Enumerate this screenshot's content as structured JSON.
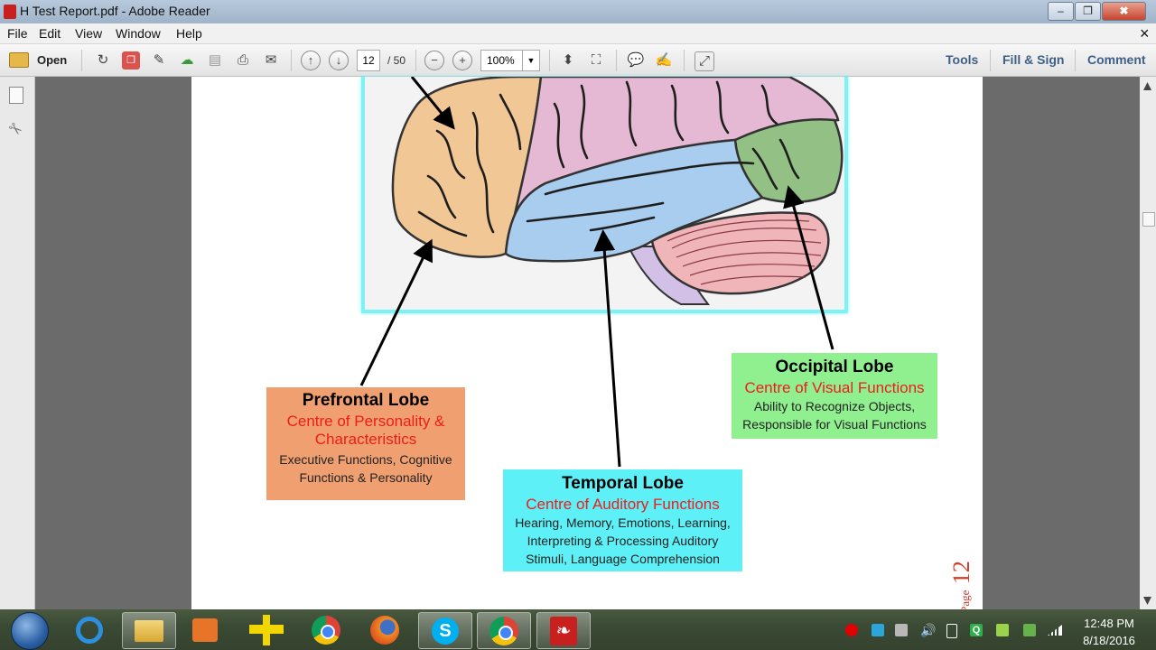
{
  "window": {
    "title": "H Test Report.pdf - Adobe Reader",
    "minimize_glyph": "–",
    "restore_glyph": "❐",
    "close_glyph": "✖"
  },
  "menu": {
    "items": [
      "File",
      "Edit",
      "View",
      "Window",
      "Help"
    ],
    "close_glyph": "×"
  },
  "toolbar": {
    "open_label": "Open",
    "page_current": "12",
    "page_total": "/ 50",
    "zoom_value": "100%",
    "links": [
      "Tools",
      "Fill & Sign",
      "Comment"
    ]
  },
  "document": {
    "prefrontal": {
      "title": "Prefrontal Lobe",
      "subtitle_line1": "Centre of Personality &",
      "subtitle_line2": "Characteristics",
      "body_line1": "Executive Functions, Cognitive",
      "body_line2": "Functions & Personality",
      "color": "#f0a070"
    },
    "temporal": {
      "title": "Temporal Lobe",
      "subtitle": "Centre of Auditory Functions",
      "body_line1": "Hearing, Memory, Emotions, Learning,",
      "body_line2": "Interpreting & Processing Auditory",
      "body_line3": "Stimuli, Language Comprehension",
      "color": "#5ef0f7"
    },
    "occipital": {
      "title": "Occipital Lobe",
      "subtitle": "Centre of Visual Functions",
      "body_line1": "Ability to Recognize Objects,",
      "body_line2": "Responsible for Visual Functions",
      "color": "#90f090"
    },
    "page_label_word": "Page",
    "page_label_number": "12"
  },
  "brain_colors": {
    "frontal": "#f2c796",
    "parietal": "#e5b9d3",
    "temporal": "#a9cdef",
    "occipital": "#93c084",
    "cerebellum": "#f0b5b9",
    "brainstem": "#d2c0e6"
  },
  "taskbar": {
    "apps": [
      "windows-start",
      "internet-explorer",
      "file-explorer",
      "media-player",
      "ruler-tool",
      "chrome",
      "firefox",
      "skype",
      "chrome-window",
      "adobe-reader"
    ],
    "clock_time": "12:48 PM",
    "clock_date": "8/18/2016"
  }
}
